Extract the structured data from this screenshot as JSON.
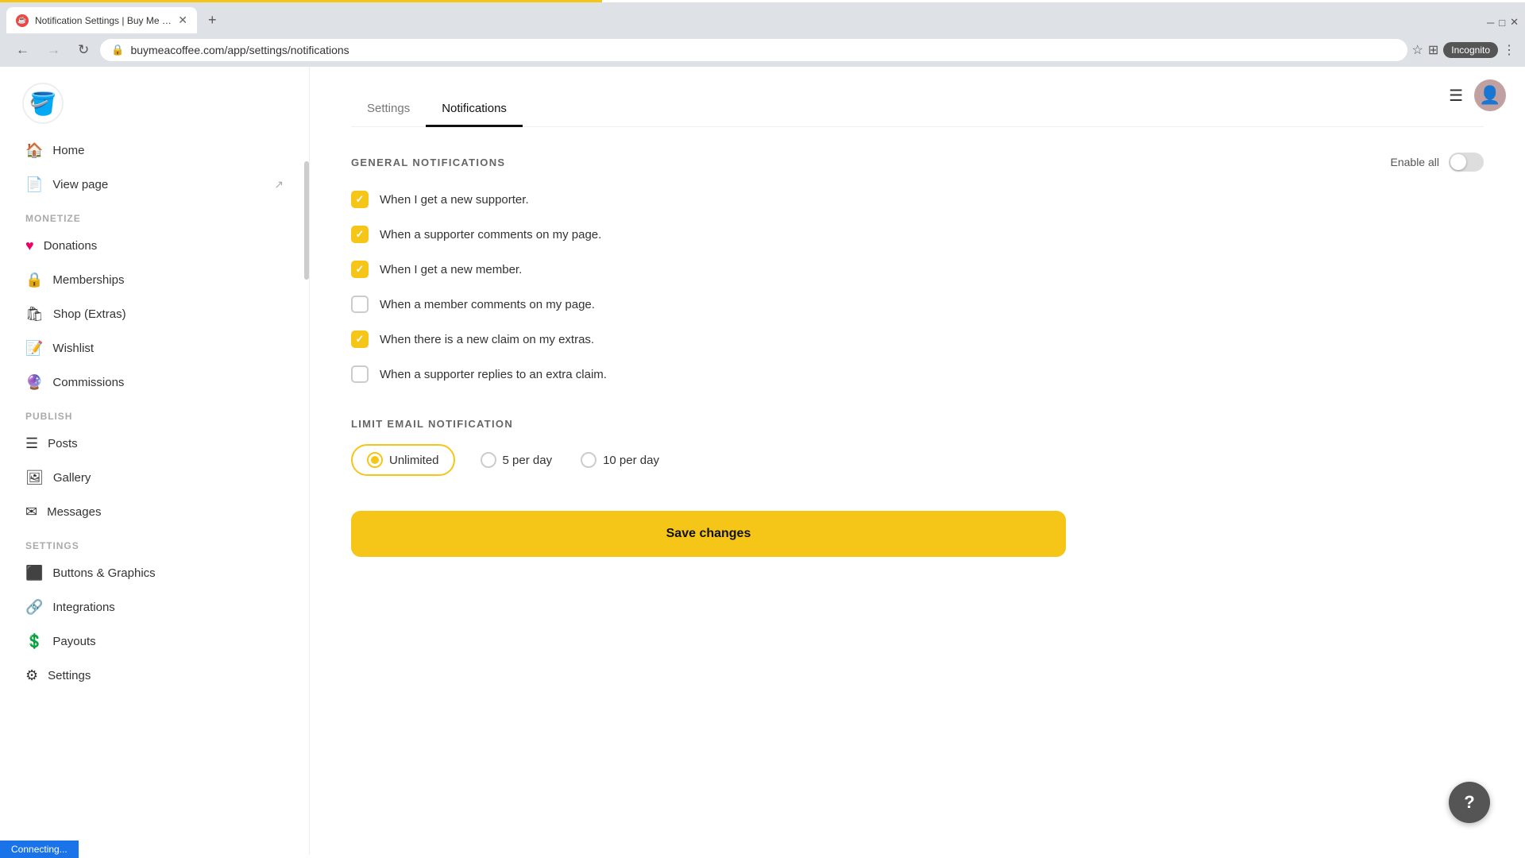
{
  "browser": {
    "tab_title": "Notification Settings | Buy Me a...",
    "tab_favicon": "☕",
    "url": "buymeacoffee.com/app/settings/notifications",
    "incognito_label": "Incognito",
    "new_tab_label": "+"
  },
  "sidebar": {
    "logo_emoji": "🪣",
    "nav_items": [
      {
        "id": "home",
        "label": "Home",
        "icon": "🏠",
        "has_ext": false
      },
      {
        "id": "view-page",
        "label": "View page",
        "icon": "📄",
        "has_ext": true
      }
    ],
    "monetize_section": "MONETIZE",
    "monetize_items": [
      {
        "id": "donations",
        "label": "Donations",
        "icon": "♥"
      },
      {
        "id": "memberships",
        "label": "Memberships",
        "icon": "🔒"
      },
      {
        "id": "shop-extras",
        "label": "Shop (Extras)",
        "icon": "🛍"
      },
      {
        "id": "wishlist",
        "label": "Wishlist",
        "icon": "📝"
      },
      {
        "id": "commissions",
        "label": "Commissions",
        "icon": "🔮"
      }
    ],
    "publish_section": "PUBLISH",
    "publish_items": [
      {
        "id": "posts",
        "label": "Posts",
        "icon": "☰"
      },
      {
        "id": "gallery",
        "label": "Gallery",
        "icon": "🖼"
      },
      {
        "id": "messages",
        "label": "Messages",
        "icon": "✉"
      }
    ],
    "settings_section": "SETTINGS",
    "settings_items": [
      {
        "id": "buttons-graphics",
        "label": "Buttons & Graphics",
        "icon": "⬛"
      },
      {
        "id": "integrations",
        "label": "Integrations",
        "icon": "🔗"
      },
      {
        "id": "payouts",
        "label": "Payouts",
        "icon": "💲"
      },
      {
        "id": "settings",
        "label": "Settings",
        "icon": "⚙"
      }
    ]
  },
  "main": {
    "tab_settings_label": "Settings",
    "tab_notifications_label": "Notifications",
    "general_notifications_title": "GENERAL NOTIFICATIONS",
    "enable_all_label": "Enable all",
    "notifications": [
      {
        "id": "new-supporter",
        "label": "When I get a new supporter.",
        "checked": true
      },
      {
        "id": "supporter-comments",
        "label": "When a supporter comments on my page.",
        "checked": true
      },
      {
        "id": "new-member",
        "label": "When I get a new member.",
        "checked": true
      },
      {
        "id": "member-comments",
        "label": "When a member comments on my page.",
        "checked": false
      },
      {
        "id": "new-claim",
        "label": "When there is a new claim on my extras.",
        "checked": true
      },
      {
        "id": "supporter-replies",
        "label": "When a supporter replies to an extra claim.",
        "checked": false
      }
    ],
    "limit_email_title": "LIMIT EMAIL NOTIFICATION",
    "email_options": [
      {
        "id": "unlimited",
        "label": "Unlimited",
        "selected": true
      },
      {
        "id": "5-per-day",
        "label": "5 per day",
        "selected": false
      },
      {
        "id": "10-per-day",
        "label": "10 per day",
        "selected": false
      }
    ],
    "save_button_label": "Save changes"
  },
  "status_bar": {
    "text": "Connecting..."
  },
  "help_button": {
    "icon": "?"
  }
}
